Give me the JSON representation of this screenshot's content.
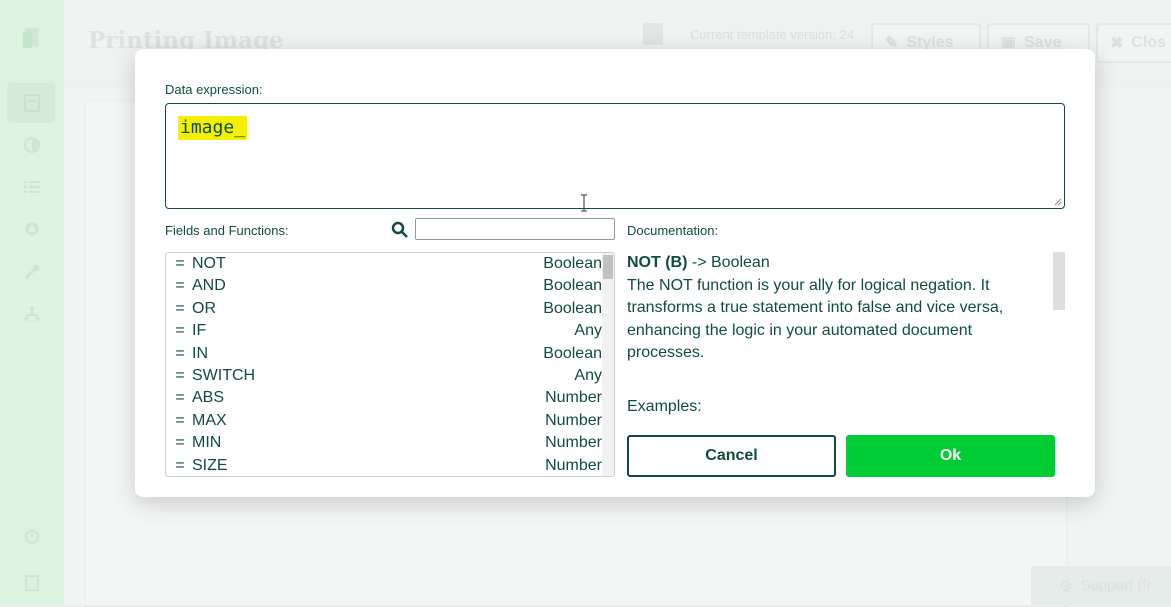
{
  "background": {
    "page_title": "Printing Image",
    "template_version": "Current template version: 24",
    "styles_label": "Styles",
    "save_label": "Save",
    "close_label": "Clos",
    "support_label": "Support (fr"
  },
  "dialog": {
    "expression_label": "Data expression:",
    "expression_value": "image_",
    "fields_label": "Fields and Functions:",
    "search_value": "",
    "documentation_label": "Documentation:",
    "functions": [
      {
        "name": "NOT",
        "type": "Boolean"
      },
      {
        "name": "AND",
        "type": "Boolean"
      },
      {
        "name": "OR",
        "type": "Boolean"
      },
      {
        "name": "IF",
        "type": "Any"
      },
      {
        "name": "IN",
        "type": "Boolean"
      },
      {
        "name": "SWITCH",
        "type": "Any"
      },
      {
        "name": "ABS",
        "type": "Number"
      },
      {
        "name": "MAX",
        "type": "Number"
      },
      {
        "name": "MIN",
        "type": "Number"
      },
      {
        "name": "SIZE",
        "type": "Number"
      }
    ],
    "doc_signature_name": "NOT (B)",
    "doc_signature_return": " -> Boolean",
    "doc_description": "The NOT function is your ally for logical negation. It transforms a true statement into false and vice versa, enhancing the logic in your automated document processes.",
    "examples_label": "Examples:",
    "cancel_label": "Cancel",
    "ok_label": "Ok"
  },
  "colors": {
    "accent": "#00cc33",
    "text": "#0f4d3a",
    "highlight": "#f4f000"
  }
}
